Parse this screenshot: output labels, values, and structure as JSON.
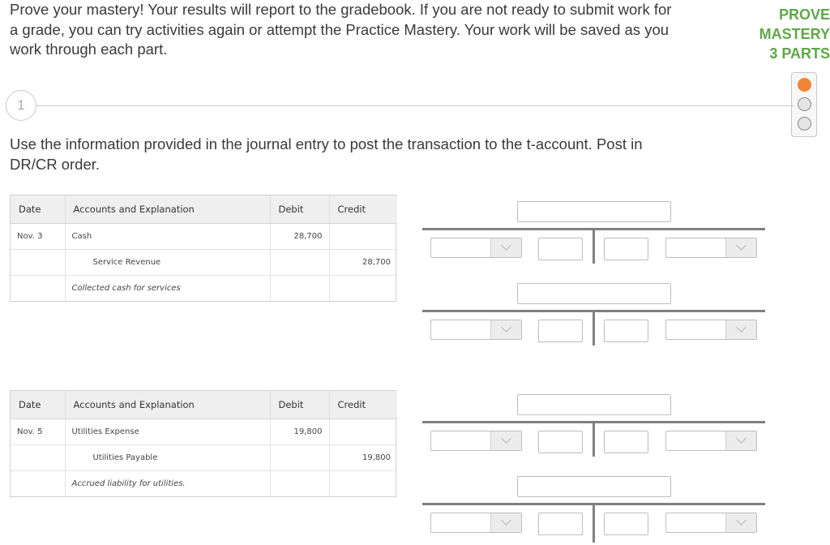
{
  "intro_text": "Prove your mastery! Your results will report to the gradebook. If you are not ready to submit work for a grade, you can try activities again or attempt the Practice Mastery. Your work will be saved as you work through each part.",
  "side_label": {
    "line1": "PROVE",
    "line2": "MASTERY",
    "line3": "3 PARTS"
  },
  "step": {
    "number": "1"
  },
  "stepper": {
    "parts": 3,
    "active_part": 1,
    "active_color": "#f0853a"
  },
  "instruction": "Use the information provided in the journal entry to post the transaction to the t-account. Post in DR/CR order.",
  "journal_headers": {
    "date": "Date",
    "accounts": "Accounts and Explanation",
    "debit": "Debit",
    "credit": "Credit"
  },
  "journals": [
    {
      "rows": [
        {
          "date": "Nov. 3",
          "account": "Cash",
          "debit": "28,700",
          "credit": ""
        },
        {
          "date": "",
          "account": "Service Revenue",
          "debit": "",
          "credit": "28,700"
        },
        {
          "date": "",
          "account": "Collected cash for services",
          "debit": "",
          "credit": ""
        }
      ]
    },
    {
      "rows": [
        {
          "date": "Nov. 5",
          "account": "Utilities Expense",
          "debit": "19,800",
          "credit": ""
        },
        {
          "date": "",
          "account": "Utilities Payable",
          "debit": "",
          "credit": "19,800"
        },
        {
          "date": "",
          "account": "Accrued liability for utilities.",
          "debit": "",
          "credit": ""
        }
      ]
    }
  ],
  "theme": {
    "accent_green": "#5fa74a",
    "text_color": "#3a3a3a"
  }
}
